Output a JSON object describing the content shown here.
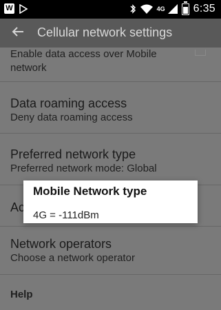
{
  "status_bar": {
    "left_icons": [
      "w-badge",
      "play-icon"
    ],
    "network_label": "4G",
    "time": "6:35"
  },
  "app_bar": {
    "title": "Cellular network settings"
  },
  "settings": {
    "item_mobile_data": {
      "subtitle_line1": "Enable data access over Mobile",
      "subtitle_line2": "network"
    },
    "item_roaming": {
      "title": "Data roaming access",
      "subtitle": "Deny data roaming access"
    },
    "item_preferred": {
      "title": "Preferred network type",
      "subtitle": "Preferred network mode: Global"
    },
    "item_partial": {
      "title": "Ac"
    },
    "item_operators": {
      "title": "Network operators",
      "subtitle": "Choose a network operator"
    },
    "item_help": {
      "title": "Help"
    }
  },
  "dialog": {
    "title": "Mobile Network type",
    "body": "4G = -111dBm"
  }
}
